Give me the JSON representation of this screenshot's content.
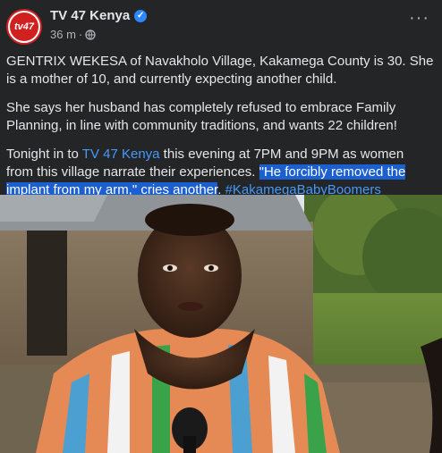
{
  "post": {
    "page_name": "TV 47 Kenya",
    "avatar_text": "tv47",
    "time": "36 m",
    "separator": "·",
    "more_label": "···",
    "paragraphs": {
      "p1": "GENTRIX WEKESA of Navakholo Village, Kakamega County is 30. She is a mother of 10, and currently expecting another child.",
      "p2": "She says her husband has completely refused to embrace Family Planning, in line with community traditions, and wants 22 children!",
      "p3_intro": "Tonight in to ",
      "p3_link": "TV 47 Kenya",
      "p3_mid": " this evening at 7PM and 9PM as women from this village narrate their experiences. ",
      "p3_highlight": "\"He forcibly removed the implant from my arm,\" cries another",
      "p3_end": ". ",
      "p3_hashtag": "#KakamegaBabyBoomers"
    }
  },
  "colors": {
    "background": "#242526",
    "text": "#e4e6eb",
    "link": "#4599ff",
    "highlight": "#1b5fd1",
    "brand_red": "#d12020"
  },
  "icons": {
    "verified": "verified-badge-icon",
    "audience": "globe-icon",
    "more": "more-horizontal-icon"
  }
}
